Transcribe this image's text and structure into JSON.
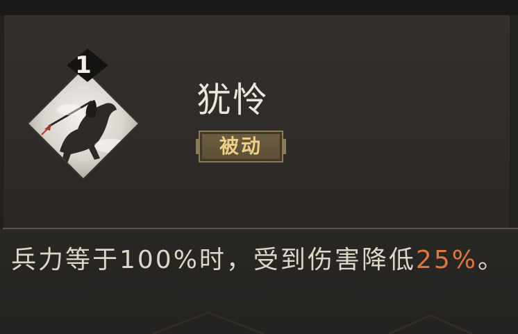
{
  "skill": {
    "level": "1",
    "name": "犹怜",
    "type_label": "被动"
  },
  "description": {
    "text_before": "兵力等于100%时，受到伤害降低",
    "highlight": "25%",
    "text_after": "。"
  },
  "icons": {
    "skill_icon": "cavalry-spear-rider-icon",
    "level_badge": "diamond-level-badge-icon"
  },
  "colors": {
    "highlight": "#e0763c",
    "badge_text": "#efcf86",
    "name_text": "#ece7dc"
  }
}
